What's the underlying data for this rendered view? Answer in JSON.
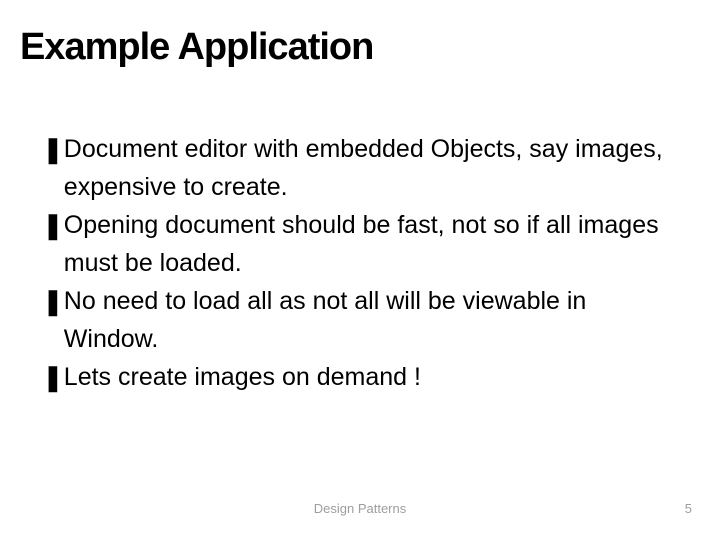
{
  "slide": {
    "title": "Example Application",
    "bullets": [
      "Document editor with embedded Objects, say images, expensive to create.",
      "Opening document should be fast, not so if all images must be loaded.",
      "No need to load all as not all will be viewable in Window.",
      "Lets create images on demand !"
    ],
    "bullet_glyph": "❚",
    "footer": "Design Patterns",
    "page_number": "5"
  }
}
